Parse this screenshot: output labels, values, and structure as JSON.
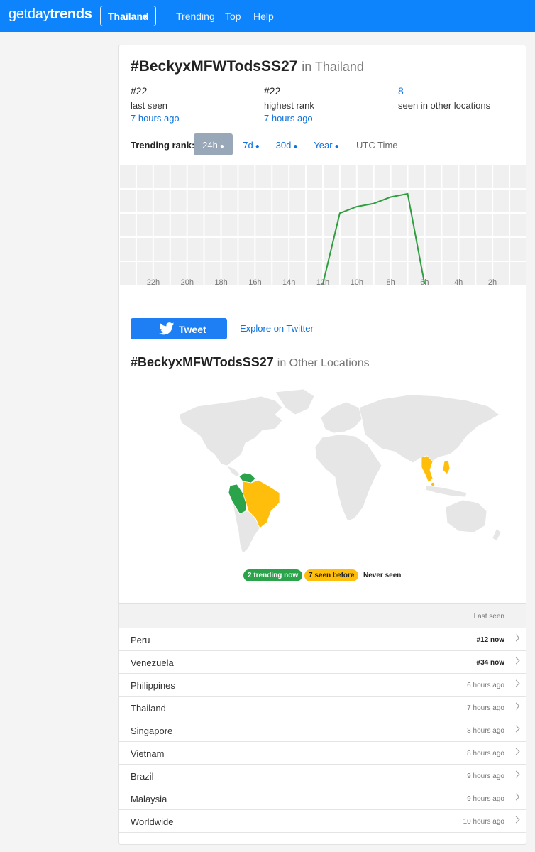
{
  "nav": {
    "logo_light": "getday",
    "logo_bold": "trends",
    "country": "Thailand",
    "links": [
      "Trending",
      "Top",
      "Help"
    ]
  },
  "trend": {
    "name": "#BeckyxMFWTodsSS27",
    "in_location": "in Thailand",
    "stats": [
      {
        "number": "#22",
        "label": "last seen",
        "when": "7 hours ago"
      },
      {
        "number": "#22",
        "label": "highest rank",
        "when": "7 hours ago"
      },
      {
        "number": "8",
        "label": "seen in other locations",
        "when": ""
      }
    ]
  },
  "rank_tabs": {
    "label": "Trending rank:",
    "tabs": [
      {
        "label": "24h",
        "active": true
      },
      {
        "label": "7d",
        "active": false
      },
      {
        "label": "30d",
        "active": false
      },
      {
        "label": "Year",
        "active": false
      }
    ],
    "utc_label": "UTC Time"
  },
  "chart_data": {
    "type": "line",
    "x": [
      "22h",
      "20h",
      "18h",
      "16h",
      "14h",
      "12h",
      "10h",
      "8h",
      "6h",
      "4h",
      "2h"
    ],
    "series": [
      {
        "color": "#2e9e3f",
        "points": [
          [
            "12h",
            50
          ],
          [
            "11h",
            28
          ],
          [
            "10h",
            26
          ],
          [
            "9h",
            25
          ],
          [
            "8h",
            23
          ],
          [
            "7h",
            22
          ],
          [
            "6h",
            50
          ]
        ]
      }
    ],
    "grid": true
  },
  "actions": {
    "tweet_label": "Tweet",
    "explore_label": "Explore on Twitter"
  },
  "other": {
    "name": "#BeckyxMFWTodsSS27",
    "in_label": "in Other Locations",
    "legend": {
      "trending": "2 trending now",
      "seen": "7 seen before",
      "never": "Never seen"
    },
    "colors": {
      "trending": "#2aa34a",
      "seen": "#ffbe0b",
      "never": "#e6e6e6"
    }
  },
  "table": {
    "header": "Last seen",
    "rows": [
      {
        "name": "Peru",
        "last": "#12 now",
        "now": true
      },
      {
        "name": "Venezuela",
        "last": "#34 now",
        "now": true
      },
      {
        "name": "Philippines",
        "last": "6 hours ago",
        "now": false
      },
      {
        "name": "Thailand",
        "last": "7 hours ago",
        "now": false
      },
      {
        "name": "Singapore",
        "last": "8 hours ago",
        "now": false
      },
      {
        "name": "Vietnam",
        "last": "8 hours ago",
        "now": false
      },
      {
        "name": "Brazil",
        "last": "9 hours ago",
        "now": false
      },
      {
        "name": "Malaysia",
        "last": "9 hours ago",
        "now": false
      },
      {
        "name": "Worldwide",
        "last": "10 hours ago",
        "now": false
      }
    ]
  }
}
